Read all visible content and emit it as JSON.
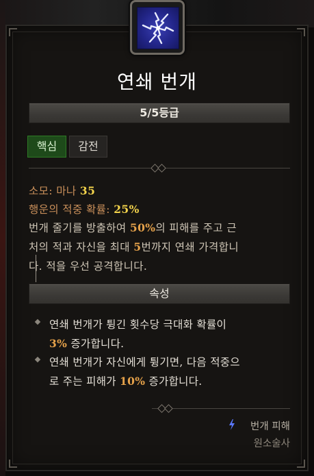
{
  "skill": {
    "name": "연쇄 번개",
    "icon": "chain-lightning-icon",
    "rank_label": "5/5등급"
  },
  "tags": [
    "핵심",
    "감전"
  ],
  "stats": {
    "cost_label": "소모: 마나 ",
    "cost_value": "35",
    "lucky_label": "행운의 적중 확률: ",
    "lucky_value": "25%"
  },
  "description": {
    "line1_pre": "번개 줄기를 방출하여 ",
    "line1_pct": "50%",
    "line1_post": "의 피해를 주고 근",
    "line2_pre": "처의 적과 자신을 최대 ",
    "line2_num": "5",
    "line2_post": "번까지 연쇄 가격합니",
    "line3": "다. 적을 우선 공격합니다."
  },
  "properties_header": "속성",
  "properties": [
    {
      "line1": "연쇄 번개가 튕긴 횟수당 극대화 확률이",
      "value": "3%",
      "line2_post": " 증가합니다."
    },
    {
      "line1": "연쇄 번개가 자신에게 튕기면, 다음 적중으",
      "line2_pre": "로 주는 피해가 ",
      "value": "10%",
      "line2_post": " 증가합니다."
    }
  ],
  "footer": {
    "damage_type": "번개 피해",
    "class_name": "원소술사",
    "damage_icon": "lightning-bolt-icon"
  },
  "colors": {
    "gold": "#e6a24a",
    "yellow": "#f3d34b",
    "label": "#c98f5a",
    "core_tag_bg": "#1e4a1a",
    "icon_blue": "#2a2d95"
  }
}
